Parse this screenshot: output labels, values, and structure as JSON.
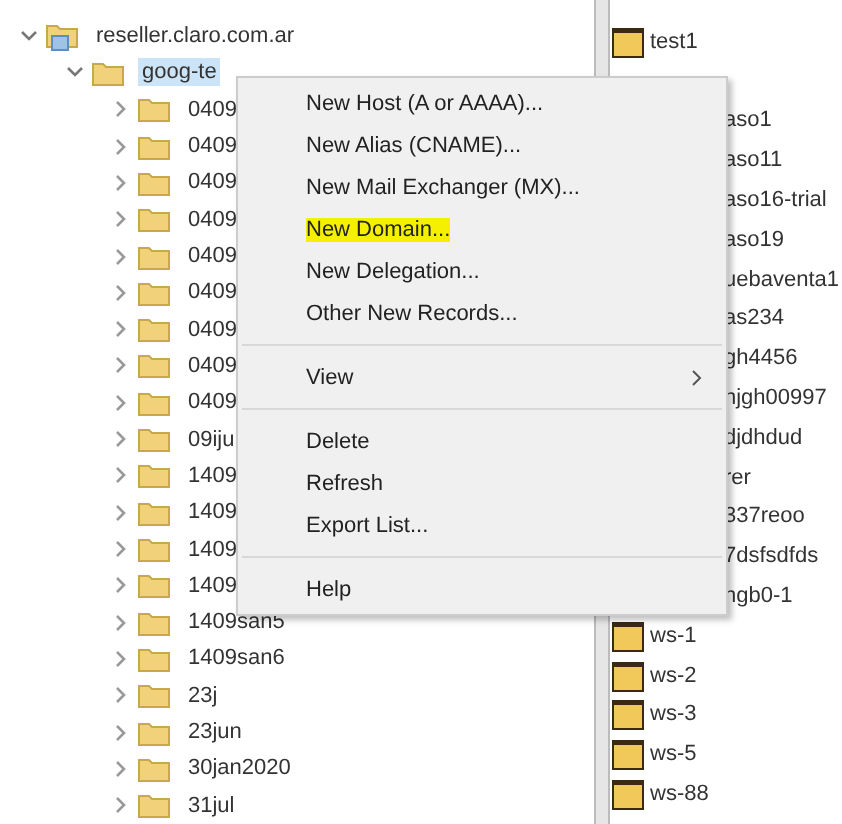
{
  "tree": {
    "items": [
      {
        "label": "reseller.claro.com.ar",
        "expanded": true,
        "kind": "zone",
        "children": [
          {
            "label": "goog-te",
            "expanded": true,
            "selected": true,
            "kind": "folder",
            "children": [
              {
                "label": "0409",
                "expanded": false,
                "kind": "folder"
              },
              {
                "label": "0409",
                "expanded": false,
                "kind": "folder"
              },
              {
                "label": "0409",
                "expanded": false,
                "kind": "folder"
              },
              {
                "label": "0409",
                "expanded": false,
                "kind": "folder"
              },
              {
                "label": "0409",
                "expanded": false,
                "kind": "folder"
              },
              {
                "label": "0409",
                "expanded": false,
                "kind": "folder"
              },
              {
                "label": "0409",
                "expanded": false,
                "kind": "folder"
              },
              {
                "label": "0409",
                "expanded": false,
                "kind": "folder"
              },
              {
                "label": "0409",
                "expanded": false,
                "kind": "folder"
              },
              {
                "label": "09iju",
                "expanded": false,
                "kind": "folder"
              },
              {
                "label": "1409",
                "expanded": false,
                "kind": "folder"
              },
              {
                "label": "1409",
                "expanded": false,
                "kind": "folder"
              },
              {
                "label": "1409",
                "expanded": false,
                "kind": "folder"
              },
              {
                "label": "1409",
                "expanded": false,
                "kind": "folder"
              },
              {
                "label": "1409san5",
                "expanded": false,
                "kind": "folder"
              },
              {
                "label": "1409san6",
                "expanded": false,
                "kind": "folder"
              },
              {
                "label": "23j",
                "expanded": false,
                "kind": "folder"
              },
              {
                "label": "23jun",
                "expanded": false,
                "kind": "folder"
              },
              {
                "label": "30jan2020",
                "expanded": false,
                "kind": "folder"
              },
              {
                "label": "31jul",
                "expanded": false,
                "kind": "folder"
              }
            ]
          }
        ]
      }
    ]
  },
  "list": {
    "items": [
      {
        "label": "test1",
        "kind": "folder"
      },
      {
        "label": "aso1",
        "kind": "covered"
      },
      {
        "label": "aso11",
        "kind": "covered"
      },
      {
        "label": "aso16-trial",
        "kind": "covered"
      },
      {
        "label": "aso19",
        "kind": "covered"
      },
      {
        "label": "uebaventa1",
        "kind": "covered"
      },
      {
        "label": "as234",
        "kind": "covered"
      },
      {
        "label": "gh4456",
        "kind": "covered"
      },
      {
        "label": "hjgh00997",
        "kind": "covered"
      },
      {
        "label": "djdhdud",
        "kind": "covered"
      },
      {
        "label": "rer",
        "kind": "covered"
      },
      {
        "label": "337reoo",
        "kind": "covered"
      },
      {
        "label": "7dsfsdfds",
        "kind": "covered"
      },
      {
        "label": "hgb0-1",
        "kind": "covered"
      },
      {
        "label": "ws-1",
        "kind": "folder"
      },
      {
        "label": "ws-2",
        "kind": "folder"
      },
      {
        "label": "ws-3",
        "kind": "folder"
      },
      {
        "label": "ws-5",
        "kind": "folder"
      },
      {
        "label": "ws-88",
        "kind": "folder"
      }
    ]
  },
  "context_menu": {
    "groups": [
      [
        {
          "label": "New Host (A or AAAA)...",
          "highlighted": false,
          "submenu": false
        },
        {
          "label": "New Alias (CNAME)...",
          "highlighted": false,
          "submenu": false
        },
        {
          "label": "New Mail Exchanger (MX)...",
          "highlighted": false,
          "submenu": false
        },
        {
          "label": "New Domain...",
          "highlighted": true,
          "submenu": false
        },
        {
          "label": "New Delegation...",
          "highlighted": false,
          "submenu": false
        },
        {
          "label": "Other New Records...",
          "highlighted": false,
          "submenu": false
        }
      ],
      [
        {
          "label": "View",
          "highlighted": false,
          "submenu": true
        }
      ],
      [
        {
          "label": "Delete",
          "highlighted": false,
          "submenu": false
        },
        {
          "label": "Refresh",
          "highlighted": false,
          "submenu": false
        },
        {
          "label": "Export List...",
          "highlighted": false,
          "submenu": false
        }
      ],
      [
        {
          "label": "Help",
          "highlighted": false,
          "submenu": false
        }
      ]
    ]
  }
}
